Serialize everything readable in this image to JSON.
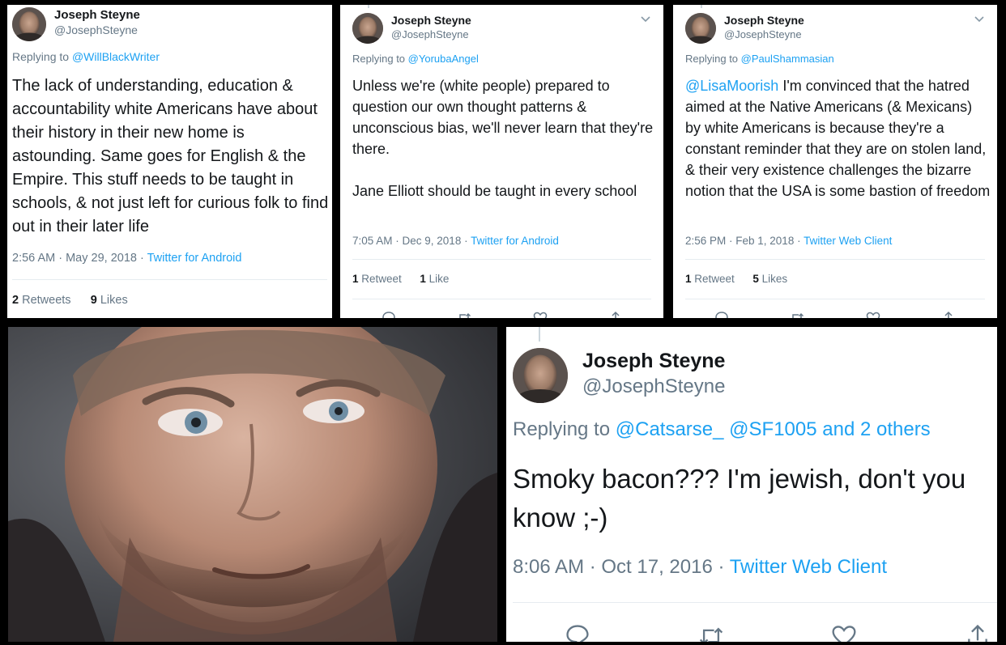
{
  "tweets": [
    {
      "name": "Joseph Steyne",
      "handle": "@JosephSteyne",
      "reply_prefix": "Replying to",
      "reply_to": "@WillBlackWriter",
      "text": "The lack of understanding, education & accountability white Americans have about their history in their new home is astounding. Same goes for English & the Empire.  This stuff needs to be taught in schools, & not just left for curious folk to find out in their later life",
      "time": "2:56 AM · May 29, 2018 ·",
      "source": "Twitter for Android",
      "retweets_n": "2",
      "retweets_label": "Retweets",
      "likes_n": "9",
      "likes_label": "Likes"
    },
    {
      "name": "Joseph Steyne",
      "handle": "@JosephSteyne",
      "reply_prefix": "Replying to",
      "reply_to": "@YorubaAngel",
      "text_p1": "Unless we're (white people) prepared to question our own thought patterns & unconscious bias,  we'll never learn that they're there.",
      "text_p2": "Jane Elliott should be taught in every school",
      "time": "7:05 AM · Dec 9, 2018 ·",
      "source": "Twitter for Android",
      "retweets_n": "1",
      "retweets_label": "Retweet",
      "likes_n": "1",
      "likes_label": "Like"
    },
    {
      "name": "Joseph Steyne",
      "handle": "@JosephSteyne",
      "reply_prefix": "Replying to",
      "reply_to": "@PaulShammasian",
      "mention": "@LisaMoorish",
      "text": " I'm convinced that the hatred aimed at the Native Americans (& Mexicans) by white Americans is because they're a constant reminder that they are on stolen land, & their very existence challenges the bizarre notion that the USA is some bastion of freedom",
      "time": "2:56 PM · Feb 1, 2018 ·",
      "source": "Twitter Web Client",
      "retweets_n": "1",
      "retweets_label": "Retweet",
      "likes_n": "5",
      "likes_label": "Likes"
    },
    {
      "name": "Joseph Steyne",
      "handle": "@JosephSteyne",
      "reply_prefix": "Replying to",
      "reply_to": "@Catsarse_ @SF1005 and 2 others",
      "text": "Smoky bacon??? I'm jewish, don't you know ;-)",
      "time": "8:06 AM · Oct 17, 2016 ·",
      "source": "Twitter Web Client"
    }
  ],
  "icons": [
    "reply-icon",
    "retweet-icon",
    "like-icon",
    "share-icon",
    "chevron-down-icon"
  ],
  "colors": {
    "link": "#1da1f2",
    "muted": "#657786",
    "text": "#14171a",
    "divider": "#e6ecf0"
  }
}
